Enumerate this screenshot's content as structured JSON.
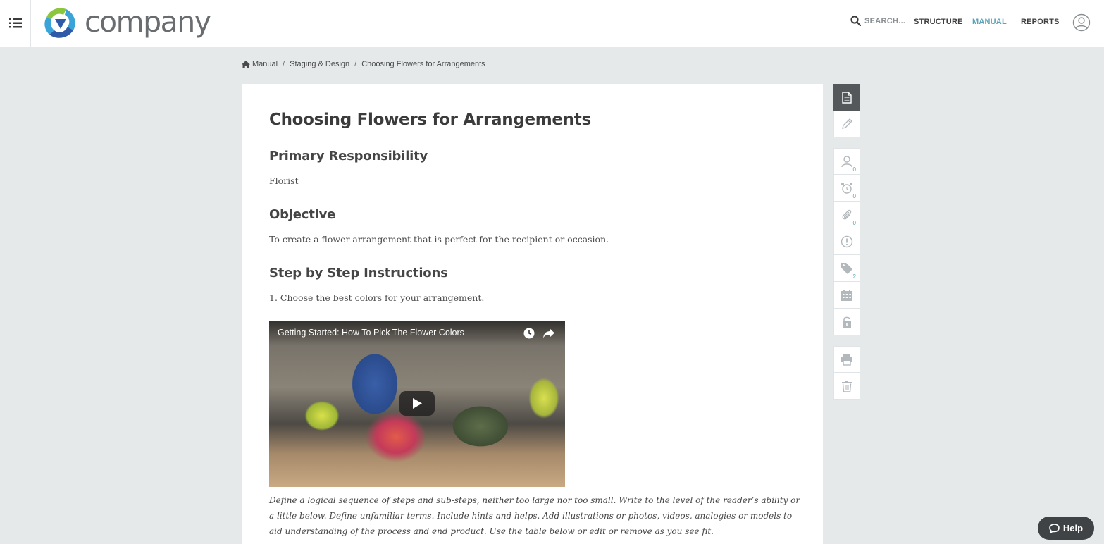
{
  "header": {
    "menu_icon": "list-icon",
    "logo_text": "company",
    "search": {
      "icon": "search-icon",
      "placeholder": "SEARCH..."
    },
    "nav": {
      "structure": "STRUCTURE",
      "manual": "MANUAL",
      "reports": "REPORTS"
    },
    "active_nav": "MANUAL",
    "user_icon": "user-circle-icon"
  },
  "breadcrumb": {
    "home_icon": "home-icon",
    "items": [
      "Manual",
      "Staging & Design",
      "Choosing Flowers for Arrangements"
    ],
    "separator": "/"
  },
  "document": {
    "title": "Choosing Flowers for Arrangements",
    "primary_heading": "Primary Responsibility",
    "primary_value": "Florist",
    "objective_heading": "Objective",
    "objective_text": "To create a flower arrangement that is perfect for the recipient or occasion.",
    "steps_heading": "Step by Step Instructions",
    "step_1": "1. Choose the best colors for your arrangement.",
    "video": {
      "title": "Getting Started: How To Pick The Flower Colors",
      "icons": [
        "watch-later-icon",
        "share-icon",
        "play-icon"
      ]
    },
    "caption": "Define a logical sequence of steps and sub-steps, neither too large nor too small. Write to the level of the reader’s ability or a little below. Define unfamiliar terms. Include hints and helps. Add illustrations or photos, videos, analogies or models to aid understanding of the process and end product. Use the table below or edit or remove as you see fit."
  },
  "tools": {
    "group1": [
      {
        "name": "view-document",
        "icon": "document-icon",
        "active": true
      },
      {
        "name": "edit",
        "icon": "pencil-icon"
      }
    ],
    "group2": [
      {
        "name": "assignees",
        "icon": "person-icon",
        "count": "0"
      },
      {
        "name": "reminders",
        "icon": "alarm-clock-icon",
        "count": "0"
      },
      {
        "name": "attachments",
        "icon": "paperclip-icon",
        "count": "0"
      },
      {
        "name": "alerts",
        "icon": "exclamation-icon"
      },
      {
        "name": "tags",
        "icon": "tag-icon",
        "count": "2"
      },
      {
        "name": "schedule",
        "icon": "calendar-icon"
      },
      {
        "name": "lock",
        "icon": "lock-icon"
      }
    ],
    "group3": [
      {
        "name": "print",
        "icon": "printer-icon"
      },
      {
        "name": "delete",
        "icon": "trash-icon"
      }
    ]
  },
  "help": {
    "label": "Help",
    "icon": "chat-bubble-icon"
  },
  "colors": {
    "accent": "#5ba3b5",
    "header_bg": "#ffffff",
    "page_bg": "#e6e9ea",
    "active_tool_bg": "#55585b",
    "help_bg": "#3f4346"
  }
}
